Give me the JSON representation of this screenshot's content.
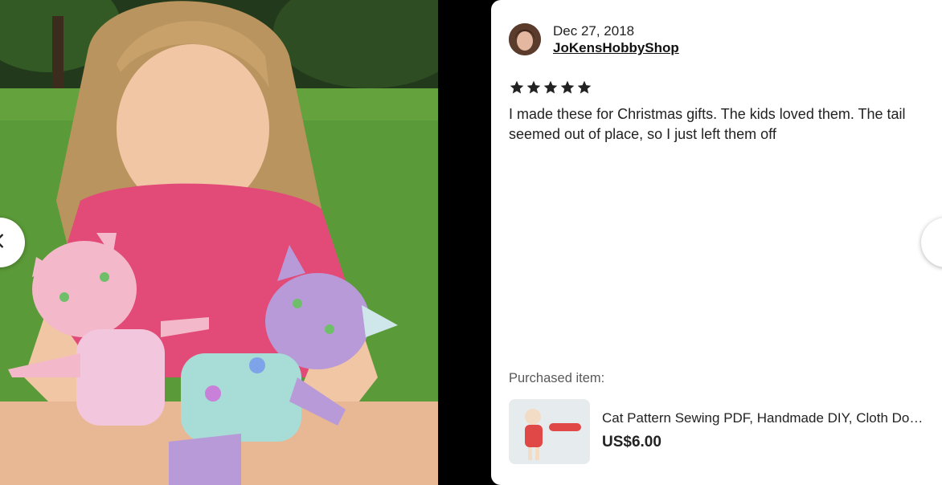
{
  "review": {
    "date": "Dec 27, 2018",
    "reviewer": "JoKensHobbyShop",
    "rating": 5,
    "rating_max": 5,
    "text": "I made these for Christmas gifts. The kids loved them. The tail seemed out of place, so I just left them off"
  },
  "purchased": {
    "label": "Purchased item:",
    "item_title": "Cat Pattern Sewing PDF, Handmade DIY, Cloth Doll Pattern",
    "price": "US$6.00"
  },
  "icons": {
    "star": "star-icon",
    "prev": "chevron-left-icon",
    "next": "chevron-right-icon"
  },
  "colors": {
    "star": "#222222",
    "panel_bg": "#ffffff",
    "backdrop": "#000000"
  }
}
